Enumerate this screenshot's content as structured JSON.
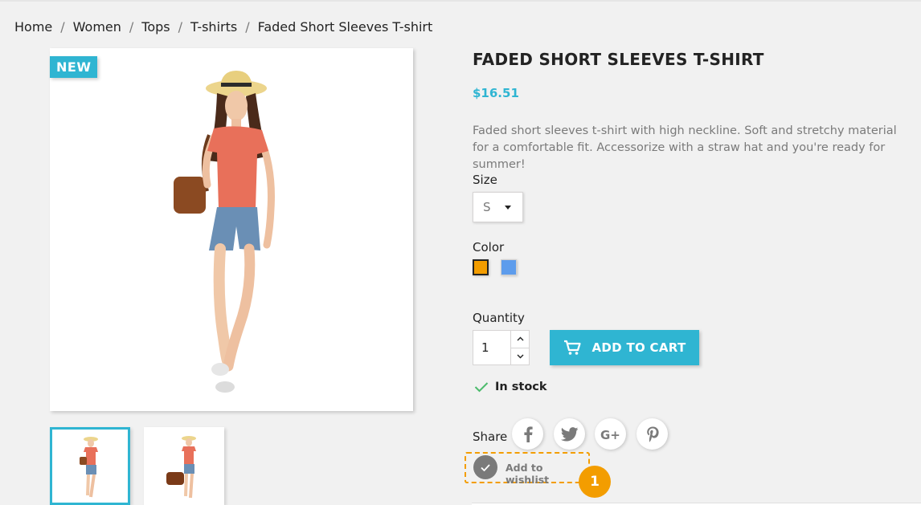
{
  "breadcrumb": {
    "items": [
      "Home",
      "Women",
      "Tops",
      "T-shirts",
      "Faded Short Sleeves T-shirt"
    ],
    "separator": "/"
  },
  "product": {
    "badge": "NEW",
    "title": "FADED SHORT SLEEVES T-SHIRT",
    "price": "$16.51",
    "description": "Faded short sleeves t-shirt with high neckline. Soft and stretchy material for a comfortable fit. Accessorize with a straw hat and you're ready for summer!",
    "size": {
      "label": "Size",
      "selected": "S"
    },
    "color": {
      "label": "Color",
      "options": [
        "#f39d00",
        "#5d9cec"
      ],
      "selected": "#f39d00"
    },
    "quantity": {
      "label": "Quantity",
      "value": "1"
    },
    "add_to_cart_label": "ADD TO CART",
    "stock_status": "In stock",
    "share_label": "Share",
    "social_icons": [
      "facebook-icon",
      "twitter-icon",
      "google-plus-icon",
      "pinterest-icon"
    ],
    "wishlist_label": "Add to wishlist",
    "step_badge": "1"
  },
  "colors": {
    "accent": "#2fb5d2",
    "highlight": "#f39d00",
    "stock_check": "#4cbb6c",
    "text_muted": "#7a7a7a"
  }
}
